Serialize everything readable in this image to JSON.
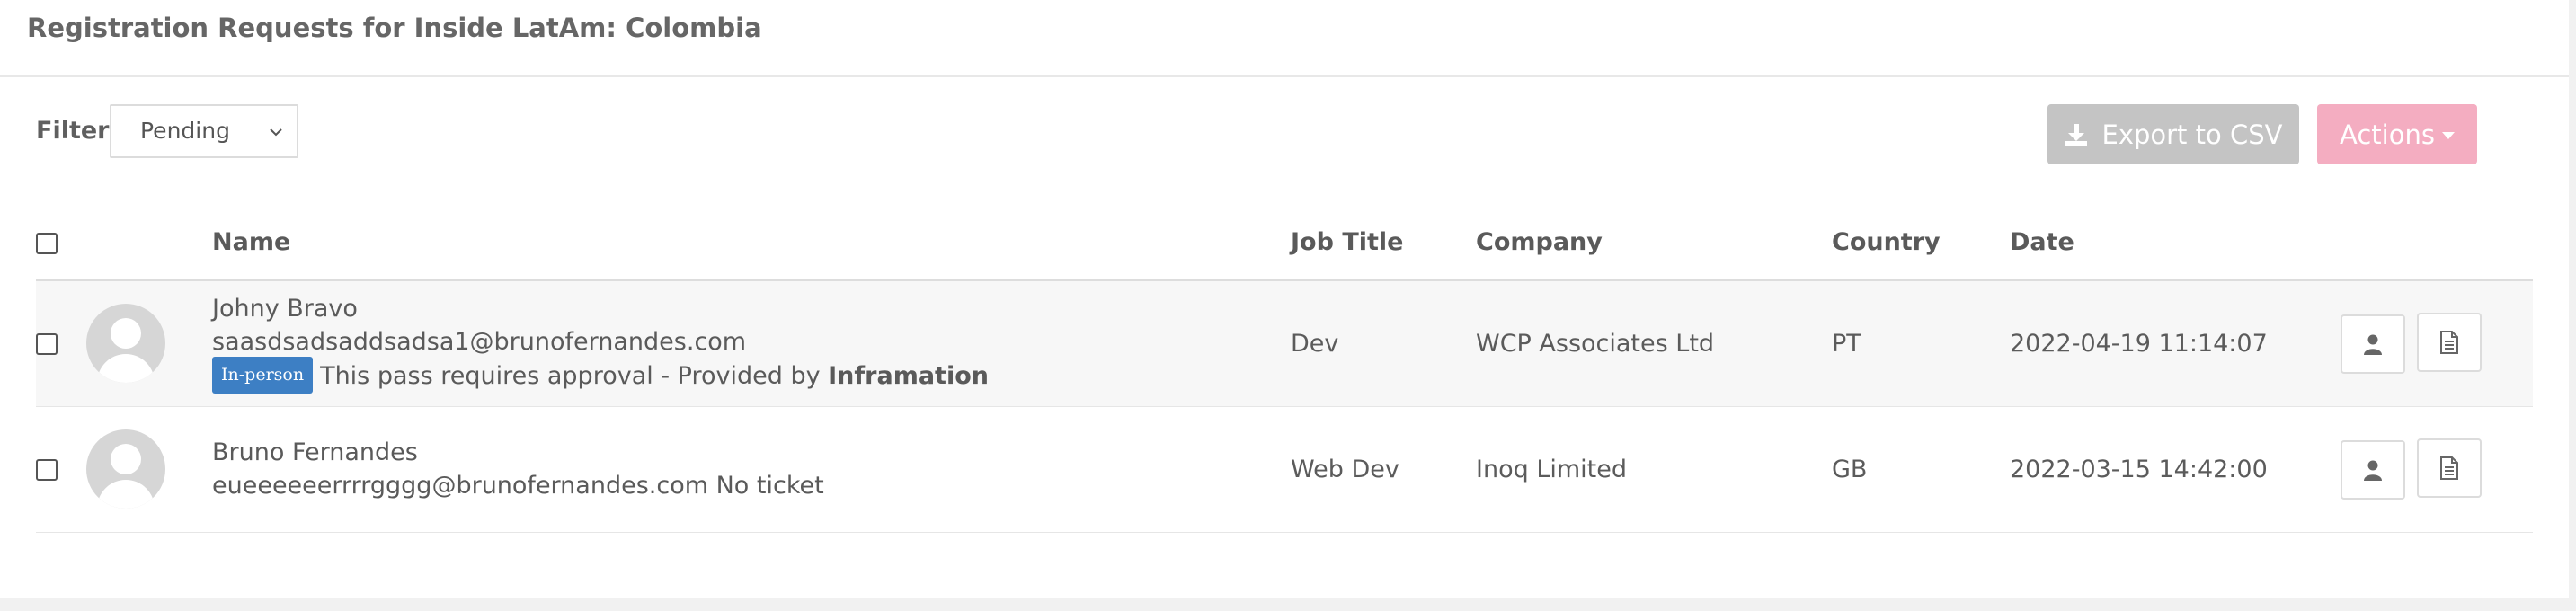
{
  "panel": {
    "title": "Registration Requests for Inside LatAm: Colombia"
  },
  "filter": {
    "label": "Filter:",
    "selected": "Pending"
  },
  "toolbar": {
    "export_label": "Export to CSV",
    "actions_label": "Actions"
  },
  "table": {
    "headers": {
      "name": "Name",
      "job_title": "Job Title",
      "company": "Company",
      "country": "Country",
      "date": "Date"
    },
    "rows": [
      {
        "name": "Johny Bravo",
        "email": "saasdsadsaddsadsa1@brunofernandes.com",
        "badge": "In-person",
        "note_prefix": "This pass requires approval - Provided by ",
        "note_provider": "Inframation",
        "job_title": "Dev",
        "company": "WCP Associates Ltd",
        "country": "PT",
        "date": "2022-04-19 11:14:07"
      },
      {
        "name": "Bruno Fernandes",
        "email": "eueeeeeerrrrgggg@brunofernandes.com",
        "ticket_note": "No ticket",
        "job_title": "Web Dev",
        "company": "Inoq Limited",
        "country": "GB",
        "date": "2022-03-15 14:42:00"
      }
    ]
  },
  "colors": {
    "export_button": "#c4c4c4",
    "actions_button": "#f4adc1",
    "badge": "#3d7fc4"
  }
}
